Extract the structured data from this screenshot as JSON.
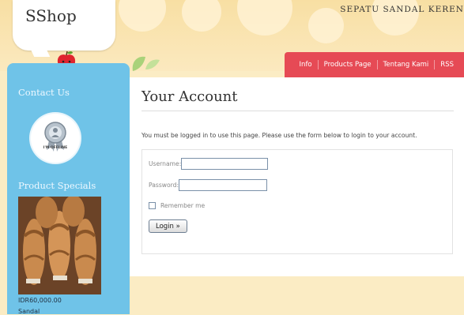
{
  "header": {
    "logo": "SShop",
    "tagline": "SEPATU SANDAL KEREN"
  },
  "nav": {
    "items": [
      "Info",
      "Products Page",
      "Tentang Kami",
      "RSS"
    ]
  },
  "sidebar": {
    "contact_heading": "Contact Us",
    "status_badge": "I'M OFFLINE",
    "specials_heading": "Product Specials",
    "product_price": "IDR60,000.00",
    "product_name": "Sandal"
  },
  "main": {
    "title": "Your Account",
    "notice": "You must be logged in to use this page. Please use the form below to login to your account.",
    "form": {
      "username_label": "Username:",
      "username_value": "",
      "password_label": "Password:",
      "password_value": "",
      "remember_label": "Remember me",
      "remember_checked": false,
      "login_button": "Login »"
    }
  },
  "colors": {
    "page_bg": "#fbecc4",
    "nav_bg": "#e64a55",
    "sidebar_bg": "#6fc3e8"
  }
}
